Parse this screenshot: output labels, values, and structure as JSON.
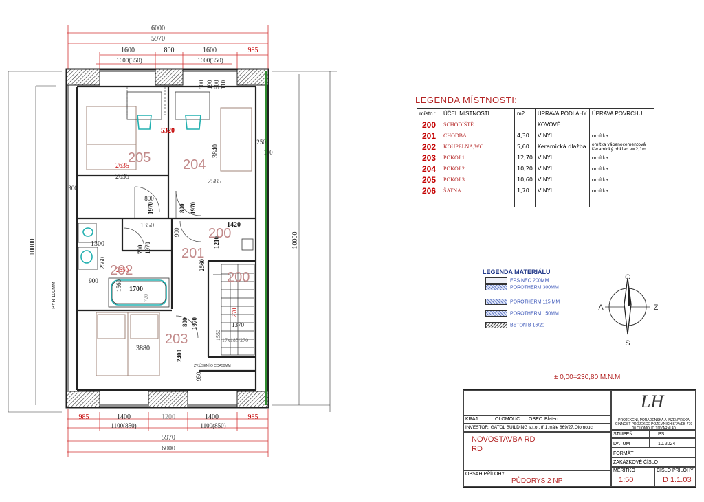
{
  "plan": {
    "dims_top": [
      "6000",
      "5970",
      "1600",
      "800",
      "1600",
      "985",
      "1600(350)",
      "1600(350)"
    ],
    "dims_bottom": [
      "985",
      "1400",
      "1200",
      "1400",
      "985",
      "1100(850)",
      "1100(850)",
      "5970",
      "6000"
    ],
    "dims_side": [
      "10000",
      "10000",
      "PYR 100MM"
    ],
    "dims_inner": [
      "5320",
      "3840",
      "250",
      "110",
      "2635",
      "2635",
      "2585",
      "300",
      "800",
      "1970",
      "800",
      "1970",
      "1350",
      "1420",
      "900",
      "1300",
      "1210",
      "700",
      "1970",
      "2560",
      "2650",
      "2560",
      "1560",
      "900",
      "1700",
      "720",
      "800",
      "1970",
      "1370",
      "270",
      "1550",
      "17x185/270",
      "3880",
      "2400",
      "950",
      "500",
      "190",
      "500",
      "110"
    ],
    "rooms": {
      "r205": "205",
      "r204": "204",
      "r200a": "200",
      "r201": "201",
      "r202": "202",
      "r200b": "200",
      "r203": "203"
    },
    "note": "ZV.ÚSENÍ O CCA50MM"
  },
  "legend": {
    "title": "LEGENDA   MÍSTNOSTI:",
    "headers": [
      "místn.:",
      "ÚČEL MÍSTNOSTI",
      "m2",
      "ÚPRAVA PODLAHY",
      "ÚPRAVA POVRCHU"
    ],
    "rows": [
      {
        "num": "200",
        "name": "SCHODIŠTĚ",
        "area": "",
        "floor": "KOVOVÉ",
        "wall": ""
      },
      {
        "num": "201",
        "name": "CHODBA",
        "area": "4,30",
        "floor": "VINYL",
        "wall": "omítka"
      },
      {
        "num": "202",
        "name": "KOUPELNA,WC",
        "area": "5,60",
        "floor": "Keramická dlažba",
        "wall": "omítka vápenocementová Keramický obklad v=2,1m"
      },
      {
        "num": "203",
        "name": "POKOJ 1",
        "area": "12,70",
        "floor": "VINYL",
        "wall": "omítka"
      },
      {
        "num": "204",
        "name": "POKOJ 2",
        "area": "10,20",
        "floor": "VINYL",
        "wall": "omítka"
      },
      {
        "num": "205",
        "name": "POKOJ 3",
        "area": "10,60",
        "floor": "VINYL",
        "wall": "omítka"
      },
      {
        "num": "206",
        "name": "ŠATNA",
        "area": "1,70",
        "floor": "VINYL",
        "wall": "omítka"
      }
    ]
  },
  "materials": {
    "title": "LEGENDA MATERIÁLU",
    "items": [
      "EPS NEO 200MM",
      "POROTHERM   300MM",
      "POROTHERM 115 MM",
      "POROTHERM   150MM",
      "BETON B 16/20"
    ]
  },
  "compass": {
    "n": "C",
    "s": "S",
    "e": "Z",
    "w": "A"
  },
  "elevation": "± 0,00=230,80 M.N.M",
  "title_block": {
    "kraj_label": "KRAJ:",
    "kraj_value": "OLOMOUC",
    "obec_label": "OBEC:",
    "obec_value": "Blatec",
    "investor": "INVESTOR: GATOL BUILDING s.r.o., tř.1.máje 869/27,Olomouc",
    "company": "PROJEKČNÍ, PORADENSKÁ A INŽENÝRSKÁ ČINNOST PROJEKCE POZEMNÍCH STAVEB 779 00 OLOMOUC,TOVÁRNÍ 40",
    "logo": "LH",
    "project1": "NOVOSTAVBA  RD",
    "project2": "RD",
    "stupen_label": "STUPEŇ",
    "stupen_value": "PS",
    "datum_label": "DATUM",
    "datum_value": "10.2024",
    "format_label": "FORMÁT",
    "zakazka_label": "ZAKÁZKOVÉ ČÍSLO",
    "obsah_label": "OBSAH PŘÍLOHY",
    "obsah_value": "PŮDORYS 2 NP",
    "meritko_label": "MĚŘÍTKO",
    "meritko_value": "1:50",
    "priloha_label": "ČÍSLO PŘÍLOHY",
    "priloha_value": "D 1.1.03"
  },
  "colors": {
    "red": "#c40000",
    "dim_red": "#d23232",
    "blue": "#3a55b8",
    "wall": "#222222"
  }
}
